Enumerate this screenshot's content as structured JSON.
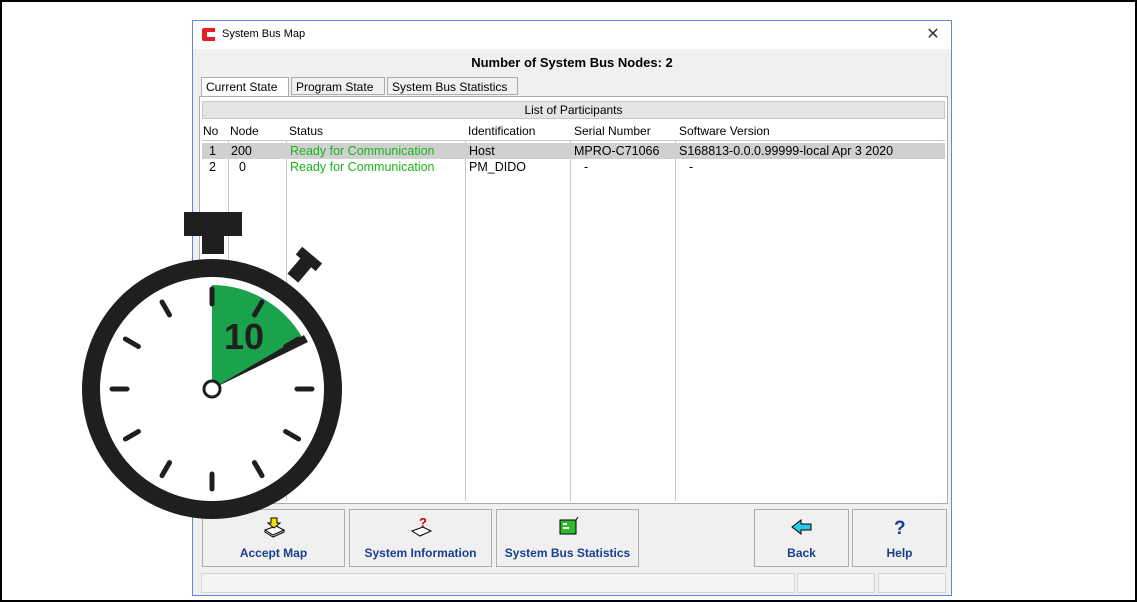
{
  "window": {
    "title": "System Bus Map",
    "heading": "Number of System Bus Nodes: 2",
    "close_glyph": "✕"
  },
  "tabs": [
    {
      "label": "Current State",
      "active": true
    },
    {
      "label": "Program State",
      "active": false
    },
    {
      "label": "System Bus Statistics",
      "active": false
    }
  ],
  "list": {
    "caption": "List of Participants",
    "columns": [
      "No",
      "Node",
      "Status",
      "Identification",
      "Serial Number",
      "Software Version"
    ],
    "rows": [
      {
        "no": "1",
        "node": "200",
        "status": "Ready for Communication",
        "identification": "Host",
        "serial": "MPRO-C71066",
        "software": "S168813-0.0.0.99999-local Apr  3 2020",
        "selected": true
      },
      {
        "no": "2",
        "node": "0",
        "status": "Ready for Communication",
        "identification": "PM_DIDO",
        "serial": "-",
        "software": "-",
        "selected": false
      }
    ]
  },
  "buttons": [
    {
      "label": "Accept Map",
      "icon": "accept-map-icon"
    },
    {
      "label": "System Information",
      "icon": "system-information-icon"
    },
    {
      "label": "System Bus Statistics",
      "icon": "bus-statistics-icon"
    },
    {
      "label": "Back",
      "icon": "back-arrow-icon"
    },
    {
      "label": "Help",
      "icon": "help-icon"
    }
  ],
  "overlay": {
    "timer_number": "10",
    "accent": "#1aa34a"
  },
  "colors": {
    "status_ready": "#1bb41b",
    "button_label": "#1a3e8f",
    "selected_row": "#d0d0d0"
  }
}
